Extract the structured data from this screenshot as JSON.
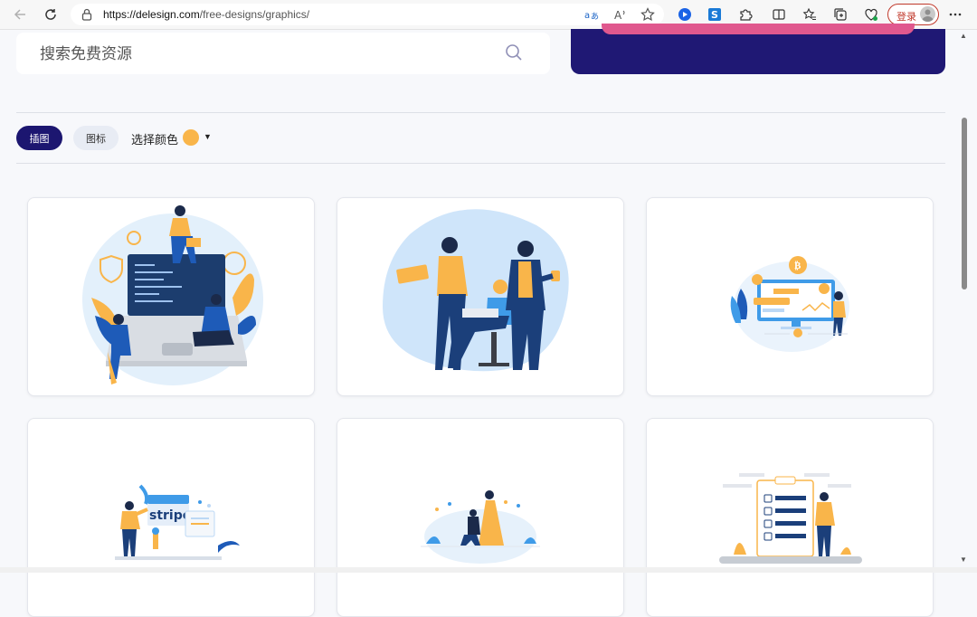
{
  "browser": {
    "url_host": "https://delesign.com",
    "url_path": "/free-designs/graphics/",
    "login_label": "登录"
  },
  "search": {
    "placeholder": "搜索免费资源"
  },
  "filters": {
    "tabs": [
      {
        "label": "插图",
        "active": true
      },
      {
        "label": "图标",
        "active": false
      }
    ],
    "color_label": "选择颜色",
    "selected_color": "#f9b54a",
    "caret": "▼"
  },
  "colors": {
    "accent_navy": "#1c1670",
    "banner_pink": "#e0588e",
    "illustration_blue": "#1e5bb8",
    "illustration_yellow": "#f9b54a"
  },
  "cards": [
    {
      "icon": "laptop-team-illustration"
    },
    {
      "icon": "office-teamwork-illustration"
    },
    {
      "icon": "bitcoin-dashboard-illustration"
    },
    {
      "icon": "stripe-payment-illustration"
    },
    {
      "icon": "proposal-couple-illustration"
    },
    {
      "icon": "checklist-clipboard-illustration"
    }
  ],
  "stripe_text": "stripe"
}
